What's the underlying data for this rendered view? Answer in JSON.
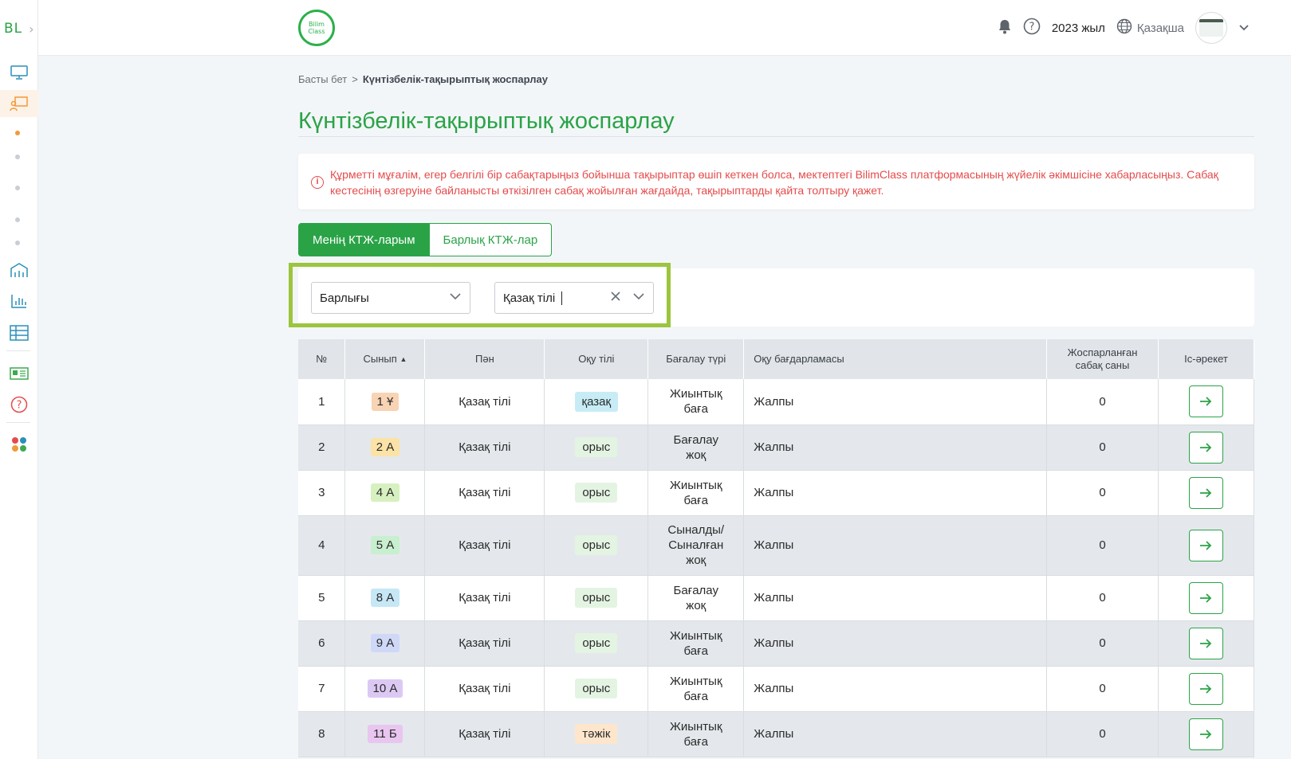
{
  "sidebar": {
    "logo": "BL",
    "expand_icon": "chevron-right-icon",
    "icons": [
      "monitor-icon",
      "teacher-icon",
      "school-icon",
      "chart-icon",
      "table-icon",
      "card-icon",
      "help-icon",
      "apps-icon"
    ]
  },
  "header": {
    "brand_line1": "Bilim",
    "brand_line2": "Class",
    "year": "2023 жыл",
    "language": "Қазақша"
  },
  "breadcrumb": {
    "home": "Басты бет",
    "separator": ">",
    "current": "Күнтізбелік-тақырыптық жоспарлау"
  },
  "page_title": "Күнтізбелік-тақырыптық жоспарлау",
  "alert": {
    "text": "Құрметті мұғалім, егер белгілі бір сабақтарыңыз бойынша тақырыптар өшіп кеткен болса, мектептегі BilimClass платформасының жүйелік әкімшісіне хабарласыңыз. Сабақ кестесінің өзгеруіне байланысты өткізілген сабақ жойылған жағдайда, тақырыптарды қайта толтыру қажет.",
    "color": "#e54b4b"
  },
  "tabs": [
    {
      "label": "Менің КТЖ-ларым",
      "active": true
    },
    {
      "label": "Барлық КТЖ-лар",
      "active": false
    }
  ],
  "filters": {
    "class_select": "Барлығы",
    "subject_select": "Қазақ тілі"
  },
  "table": {
    "headers": {
      "num": "№",
      "class": "Сынып",
      "subject": "Пән",
      "lang": "Оқу тілі",
      "assessment": "Бағалау түрі",
      "program": "Оқу бағдарламасы",
      "planned_l1": "Жоспарланған",
      "planned_l2": "сабақ саны",
      "action": "Іс-әрекет"
    },
    "rows": [
      {
        "num": "1",
        "class": "1 Ұ",
        "subject": "Қазақ тілі",
        "lang": "қазақ",
        "assessment": [
          "Жиынтық",
          "баға"
        ],
        "program": "Жалпы",
        "planned": "0"
      },
      {
        "num": "2",
        "class": "2 А",
        "subject": "Қазақ тілі",
        "lang": "орыс",
        "assessment": [
          "Бағалау",
          "жоқ"
        ],
        "program": "Жалпы",
        "planned": "0"
      },
      {
        "num": "3",
        "class": "4 А",
        "subject": "Қазақ тілі",
        "lang": "орыс",
        "assessment": [
          "Жиынтық",
          "баға"
        ],
        "program": "Жалпы",
        "planned": "0"
      },
      {
        "num": "4",
        "class": "5 А",
        "subject": "Қазақ тілі",
        "lang": "орыс",
        "assessment": [
          "Сыналды/",
          "Сыналған",
          "жоқ"
        ],
        "program": "Жалпы",
        "planned": "0"
      },
      {
        "num": "5",
        "class": "8 А",
        "subject": "Қазақ тілі",
        "lang": "орыс",
        "assessment": [
          "Бағалау",
          "жоқ"
        ],
        "program": "Жалпы",
        "planned": "0"
      },
      {
        "num": "6",
        "class": "9 А",
        "subject": "Қазақ тілі",
        "lang": "орыс",
        "assessment": [
          "Жиынтық",
          "баға"
        ],
        "program": "Жалпы",
        "planned": "0"
      },
      {
        "num": "7",
        "class": "10 А",
        "subject": "Қазақ тілі",
        "lang": "орыс",
        "assessment": [
          "Жиынтық",
          "баға"
        ],
        "program": "Жалпы",
        "planned": "0"
      },
      {
        "num": "8",
        "class": "11 Б",
        "subject": "Қазақ тілі",
        "lang": "тәжік",
        "assessment": [
          "Жиынтық",
          "баға"
        ],
        "program": "Жалпы",
        "planned": "0"
      }
    ]
  },
  "colors": {
    "brand_green": "#2aa347",
    "class_badges": [
      "#f8d3b4",
      "#fbe3a7",
      "#d6f1bf",
      "#c8efcf",
      "#c6e7f5",
      "#cfd8f7",
      "#dcc9f3",
      "#e8c6f0"
    ],
    "lang_badges": {
      "қазақ": "#c7ecf6",
      "орыс": "#e4f4e2",
      "тәжік": "#fde6cc"
    }
  }
}
